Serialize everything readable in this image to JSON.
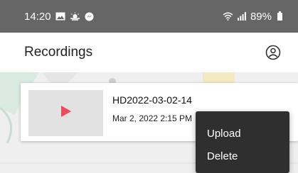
{
  "status_bar": {
    "time": "14:20",
    "battery": "89%",
    "icons": [
      "image-notification-icon",
      "weather-notification-icon",
      "messenger-notification-icon",
      "wifi-icon",
      "signal-icon",
      "battery-icon"
    ]
  },
  "app_bar": {
    "title": "Recordings",
    "action_icon": "account-circle-icon"
  },
  "recordings": [
    {
      "title": "HD2022-03-02-14",
      "date": "Mar 2, 2022 2:15 PM",
      "thumbnail_icon": "play-icon"
    }
  ],
  "menu": {
    "items": [
      {
        "label": "Upload"
      },
      {
        "label": "Delete"
      }
    ]
  },
  "colors": {
    "status_bar": "#666666",
    "play_icon": "#e84b5e",
    "menu_bg": "#2f2f2f",
    "card_thumb": "#e2e2e2"
  }
}
